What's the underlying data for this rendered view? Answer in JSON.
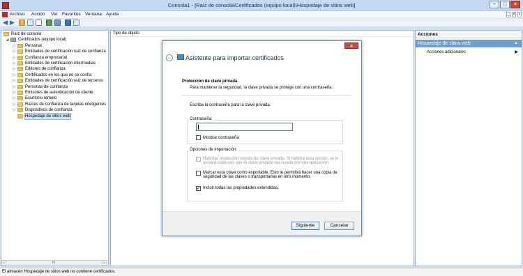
{
  "window": {
    "title": "Consola1 - [Raíz de consola\\Certificados (equipo local)\\Hospedaje de sitios web]",
    "buttons": {
      "minimize": "–",
      "maximize": "□",
      "close": "×"
    },
    "inner_buttons": {
      "minimize": "_",
      "restore": "ᴮ",
      "close": "×"
    }
  },
  "menu": [
    "Archivo",
    "Acción",
    "Ver",
    "Favoritos",
    "Ventana",
    "Ayuda"
  ],
  "tree": {
    "root": "Raíz de consola",
    "store": "Certificados (equipo local)",
    "items": [
      "Personal",
      "Entidades de certificación raíz de confianza",
      "Confianza empresarial",
      "Entidades de certificación intermedias",
      "Editores de confianza",
      "Certificados en los que no se confía",
      "Entidades de certificación raíz de terceros",
      "Personas de confianza",
      "Emisores de autenticación de cliente",
      "Escritorio remoto",
      "Raíces de confianza de tarjetas inteligentes",
      "Dispositivos de confianza",
      "Hospedaje de sitios web"
    ],
    "selected_index": 12
  },
  "scroll": {
    "left": "<",
    "thumb": "III",
    "right": ">"
  },
  "center": {
    "column_header": "Tipo de objeto"
  },
  "actions": {
    "header": "Acciones",
    "section_title": "Hospedaje de sitios web",
    "section_caret": "▲",
    "more": "Acciones adicionales",
    "more_arrow": "▶"
  },
  "status": "El almacén Hospedaje de sitios web no contiene certificados.",
  "dialog": {
    "close_label": "×",
    "back_glyph": "←",
    "title": "Asistente para importar certificados",
    "section_title": "Protección de clave privada",
    "section_desc": "Para mantener la seguridad, la clave privada se protege con una contraseña.",
    "prompt": "Escriba la contraseña para la clave privada.",
    "password_group": "Contraseña:",
    "password_value": "",
    "show_password": "Mostrar contraseña",
    "import_group": "Opciones de importación:",
    "option1_line1": "Habilitar protección segura de clave privada. Si habilita esta opción, se le",
    "option1_line2": "avisará cada vez que la clave privada sea usada por una aplicación.",
    "option2_line1": "Marcar esta clave como exportable. Esto le permitirá hacer una copia de",
    "option2_line2": "seguridad de las claves o transportarlas en otro momento.",
    "option3": "Incluir todas las propiedades extendidas.",
    "checkmark": "✔",
    "next_button": "Siguiente",
    "cancel_button": "Cancelar"
  }
}
